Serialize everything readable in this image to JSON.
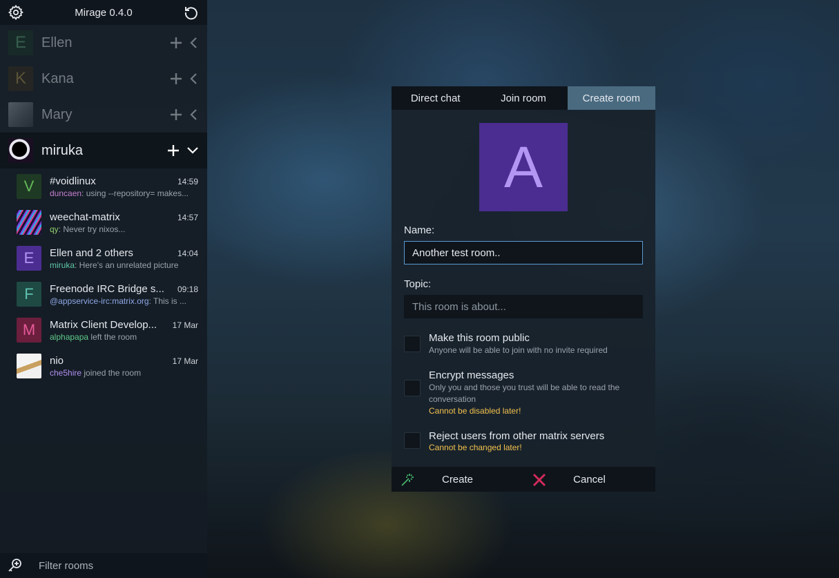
{
  "topbar": {
    "title": "Mirage 0.4.0",
    "settings_icon": "gear-icon",
    "refresh_icon": "refresh-icon"
  },
  "accounts": [
    {
      "initial": "E",
      "name": "Ellen",
      "color": "#3a6b4b"
    },
    {
      "initial": "K",
      "name": "Kana",
      "color": "#7a6a3a"
    },
    {
      "initial": "",
      "name": "Mary"
    },
    {
      "initial": "",
      "name": "miruka"
    }
  ],
  "rooms": [
    {
      "initial": "V",
      "name": "#voidlinux",
      "time": "14:59",
      "sender": "duncaen",
      "sender_color": "#c57fd0",
      "preview": ": using --repository= makes..."
    },
    {
      "initial": "",
      "name": "weechat-matrix",
      "time": "14:57",
      "sender": "qy",
      "sender_color": "#8fcf6e",
      "preview": ": Never try nixos..."
    },
    {
      "initial": "E",
      "name": "Ellen and 2 others",
      "time": "14:04",
      "sender": "miruka",
      "sender_color": "#5fc9a8",
      "preview": ": Here's an unrelated picture"
    },
    {
      "initial": "F",
      "name": "Freenode IRC Bridge s...",
      "time": "09:18",
      "sender": "@appservice-irc:matrix.org",
      "sender_color": "#8fa8e6",
      "preview": ": This is ..."
    },
    {
      "initial": "M",
      "name": "Matrix Client Develop...",
      "time": "17 Mar",
      "sender": "alphapapa",
      "sender_color": "#5fc98a",
      "preview": " left the room"
    },
    {
      "initial": "",
      "name": "nio",
      "time": "17 Mar",
      "sender": "che5hire",
      "sender_color": "#b090f0",
      "preview": " joined the room"
    }
  ],
  "filter": {
    "placeholder": "Filter rooms"
  },
  "dialog": {
    "tabs": [
      "Direct chat",
      "Join room",
      "Create room"
    ],
    "active_tab": "Create room",
    "avatar_letter": "A",
    "name_label": "Name:",
    "name_value": "Another test room..",
    "topic_label": "Topic:",
    "topic_placeholder": "This room is about...",
    "options": [
      {
        "title": "Make this room public",
        "subtitle": "Anyone will be able to join with no invite required",
        "warning": ""
      },
      {
        "title": "Encrypt messages",
        "subtitle": "Only you and those you trust will be able to read the conversation",
        "warning": "Cannot be disabled later!"
      },
      {
        "title": "Reject users from other matrix servers",
        "subtitle": "",
        "warning": "Cannot be changed later!"
      }
    ],
    "create_label": "Create",
    "cancel_label": "Cancel"
  },
  "colors": {
    "accent": "#5a9bd5",
    "warning": "#f2c14e",
    "cancel_x": "#d22a5a",
    "create_icon": "#46b46a"
  }
}
